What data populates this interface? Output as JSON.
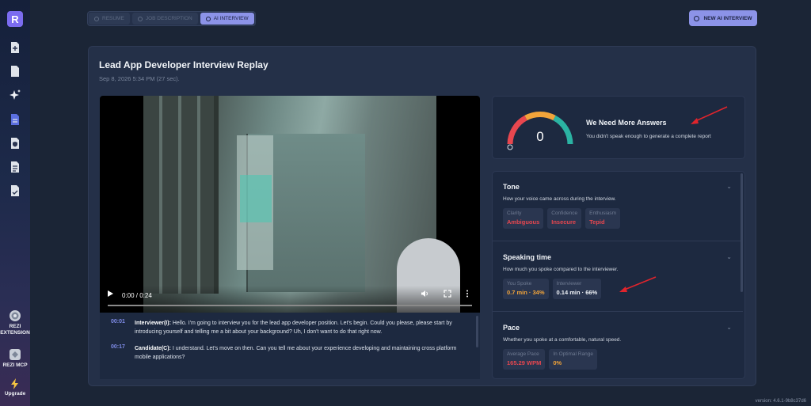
{
  "sidebar": {
    "logo": "R",
    "items": [
      {
        "icon": "file-plus-icon"
      },
      {
        "icon": "file-icon"
      },
      {
        "icon": "sparkle-icon"
      },
      {
        "icon": "file-doc-icon"
      },
      {
        "icon": "file-shield-icon"
      },
      {
        "icon": "file-lines-icon"
      },
      {
        "icon": "file-check-icon"
      }
    ],
    "bottom": {
      "extension_label": "REZI\nEXTENSION",
      "extension_line1": "REZI",
      "extension_line2": "EXTENSION",
      "mcp_label": "REZI MCP",
      "upgrade_label": "Upgrade"
    }
  },
  "tabs": [
    {
      "label": "RESUME",
      "active": false
    },
    {
      "label": "JOB DESCRIPTION",
      "active": false
    },
    {
      "label": "AI INTERVIEW",
      "active": true
    }
  ],
  "new_button": {
    "label": "NEW AI INTERVIEW"
  },
  "page": {
    "title": "Lead App Developer Interview Replay",
    "subtitle": "Sep 8, 2026 5:34 PM (27 sec)."
  },
  "video": {
    "time": "0:00 / 0:24",
    "progress": 0
  },
  "transcript": [
    {
      "time": "00:01",
      "speaker": "Interviewer(I):",
      "text": "Hello. I'm going to interview you for the lead app developer position. Let's begin. Could you please, please start by introducing yourself and telling me a bit about your background? Uh, I don't want to do that right now."
    },
    {
      "time": "00:17",
      "speaker": "Candidate(C):",
      "text": "I understand. Let's move on then. Can you tell me about your experience developing and maintaining cross platform mobile applications?"
    }
  ],
  "score": {
    "value": "0",
    "min": "0",
    "max": "100",
    "title": "We Need More Answers",
    "description": "You didn't speak enough to generate a complete report"
  },
  "metrics": {
    "tone": {
      "title": "Tone",
      "description": "How your voice came across during the interview.",
      "pills": [
        {
          "label": "Clarity",
          "value": "Ambiguous"
        },
        {
          "label": "Confidence",
          "value": "Insecure"
        },
        {
          "label": "Enthusiasm",
          "value": "Tepid"
        }
      ]
    },
    "speaking": {
      "title": "Speaking time",
      "description": "How much you spoke compared to the interviewer.",
      "pills": [
        {
          "label": "You Spoke",
          "value": "0.7 min · 34%"
        },
        {
          "label": "Interviewer",
          "value": "0.14 min · 66%"
        }
      ]
    },
    "pace": {
      "title": "Pace",
      "description": "Whether you spoke at a comfortable, natural speed.",
      "pills": [
        {
          "label": "Average Pace",
          "value": "165.29 WPM"
        },
        {
          "label": "In Optimal Range",
          "value": "0%"
        }
      ]
    }
  },
  "version": "version: 4.6.1-9b8c37d6",
  "colors": {
    "accent": "#8c93e8",
    "bad": "#e8474f",
    "warn": "#f2a43a",
    "good": "#2bb3a3"
  }
}
